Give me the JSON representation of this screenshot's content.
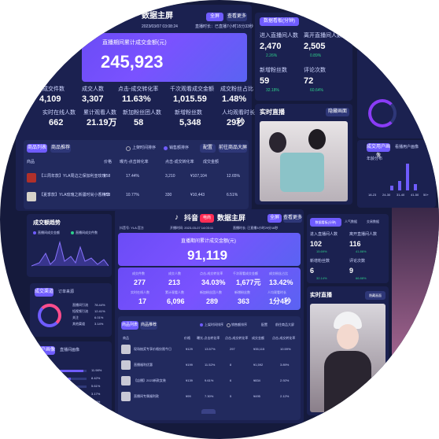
{
  "top": {
    "title": "数据主屏",
    "btn_full": "全屏",
    "btn_more": "查看更多",
    "date": "2023/03/07 03:08:24",
    "subinfo": "直播时长：已直播7小时15分33秒",
    "gmv_label": "直播期间累计成交金额(元)",
    "gmv": "245,923",
    "metrics": [
      {
        "label": "成交件数",
        "value": "4,109"
      },
      {
        "label": "成交人数",
        "value": "3,307"
      },
      {
        "label": "点击-成交转化率",
        "value": "11.63%"
      },
      {
        "label": "千次观看成交金额",
        "value": "1,015.59"
      },
      {
        "label": "成交粉丝占比",
        "value": "1.48%"
      },
      {
        "label": "实时在线人数",
        "value": "662"
      },
      {
        "label": "累计观看人数",
        "value": "21.19万"
      },
      {
        "label": "新加粉丝团人数",
        "value": "58"
      },
      {
        "label": "新增粉丝数",
        "value": "5,348"
      },
      {
        "label": "人均观看时长",
        "value": "29秒"
      }
    ],
    "tabs": [
      "商品列表",
      "商品推荐"
    ],
    "radio1": "上架时间排序",
    "radio2": "销售额排序",
    "btn_config": "配置",
    "btn_export": "前往商品大屏",
    "table_headers": [
      "商品",
      "价格",
      "曝光-点击转化率",
      "点击-成交转化率",
      "成交金额",
      "成交件数",
      "点击-成交转化率"
    ],
    "rows": [
      {
        "name": "【三周年款】YLA周边之保加利亚玫瑰",
        "price": "¥58",
        "c1": "17.44%",
        "c2": "3,210",
        "c3": "¥107,104",
        "c4": "12.65%"
      },
      {
        "name": "【夏季款】YLA玫瑰之新疆时尚小香精华",
        "price": "¥58",
        "c1": "10.77%",
        "c2": "330",
        "c3": "¥10,443",
        "c4": "6.51%"
      }
    ],
    "right_stats": [
      {
        "label": "进入直播间人数",
        "value": "2,470",
        "delta": "2.26%"
      },
      {
        "label": "离开直播间人数",
        "value": "2,505",
        "delta": "0.89%"
      },
      {
        "label": "新增粉丝数",
        "value": "59",
        "delta": "32.18%"
      },
      {
        "label": "评论次数",
        "value": "72",
        "delta": "60.64%"
      }
    ],
    "right_tab": "数据看板(分钟)",
    "live_label": "实时直播",
    "live_btn": "隐藏画面"
  },
  "chart": {
    "title": "成交额趋势",
    "legend": [
      "直播间成交金额",
      "直播间成交件数"
    ]
  },
  "main": {
    "brand": "抖音",
    "brand_tag": "电商",
    "title": "数据主屏",
    "btn_full": "全屏",
    "btn_more": "查看更多",
    "account": "抖音号: YLA.官方",
    "date": "开播时间: 2023-03-07 14:03:11",
    "duration": "直播时长: 已直播3小时29分18秒",
    "gmv_label": "直播期间累计成交金额(元)",
    "gmv": "91,119",
    "metrics": [
      {
        "label": "成交件数",
        "value": "277"
      },
      {
        "label": "成交人数",
        "value": "213"
      },
      {
        "label": "点击-成交转化率",
        "value": "34.03%"
      },
      {
        "label": "千次观看成交金额",
        "value": "1,677元"
      },
      {
        "label": "成交粉丝占比",
        "value": "13.42%"
      },
      {
        "label": "实时在线人数",
        "value": "17"
      },
      {
        "label": "累计观看人数",
        "value": "6,096"
      },
      {
        "label": "新加粉丝团人数",
        "value": "289"
      },
      {
        "label": "新增粉丝数",
        "value": "363"
      },
      {
        "label": "人均观看时长",
        "value": "1分4秒"
      }
    ],
    "tabs": [
      "商品列表",
      "商品推荐"
    ],
    "radio1": "上架时间排序",
    "radio2": "销售额排序",
    "btn_config": "配置",
    "btn_export": "前往商品大屏",
    "table_headers": [
      "商品",
      "价格",
      "曝光-点击转化率",
      "点击-成交转化率",
      "成交金额",
      "成交件数",
      "点击-成交转化率"
    ],
    "rows": [
      {
        "name": "现场抽奖专享价格仅限今日",
        "price": "¥129",
        "c1": "13.57%",
        "c2": "297",
        "c3": "¥35,115",
        "c4": "10.59%"
      },
      {
        "name": "直播福利优惠",
        "price": "¥199",
        "c1": "11.52%",
        "c2": "8",
        "c3": "¥1,592",
        "c4": "3.89%"
      },
      {
        "name": "【店播】2023新款女装",
        "price": "¥139",
        "c1": "9.61%",
        "c2": "6",
        "c3": "¥834",
        "c4": "2.92%"
      },
      {
        "name": "直播间专属福利款",
        "price": "¥99",
        "c1": "7.30%",
        "c2": "5",
        "c3": "¥495",
        "c4": "2.12%"
      }
    ]
  },
  "left": {
    "donut_tabs": [
      "成交渠道",
      "订单来源"
    ],
    "legend": [
      {
        "label": "直播间引流",
        "value": "78.44%"
      },
      {
        "label": "短视频引流",
        "value": "12.41%"
      },
      {
        "label": "关注",
        "value": "6.01%"
      },
      {
        "label": "其他渠道",
        "value": "3.14%"
      }
    ],
    "bar_tabs": [
      "用户画像",
      "直播间画像"
    ],
    "bars": [
      {
        "value": "11.98%"
      },
      {
        "value": "8.42%"
      },
      {
        "value": "5.61%"
      },
      {
        "value": "3.17%"
      },
      {
        "value": "1.20%"
      }
    ]
  },
  "right": {
    "tabs": [
      "数据看板(分钟)",
      "人气数据",
      "交易数据"
    ],
    "stats": [
      {
        "label": "进入直播间人数",
        "value": "102",
        "delta": "15.69%"
      },
      {
        "label": "离开直播间人数",
        "value": "116",
        "delta": "41.86%"
      },
      {
        "label": "新增粉丝数",
        "value": "6",
        "delta": "32.14%"
      },
      {
        "label": "评论次数",
        "value": "9",
        "delta": "66.88%"
      }
    ],
    "live_label": "实时直播",
    "live_btn": "隐藏画面",
    "age_tabs": [
      "成交用户画像",
      "看播用户画像"
    ],
    "age_label": "年龄分布",
    "age_ticks": [
      "18-23",
      "24-30",
      "31-40",
      "41-50",
      "50+"
    ]
  },
  "colors": {
    "accent": "#6f5cff",
    "bg": "#151a3c",
    "panel": "#222a5e",
    "green": "#2ecf8a",
    "pink": "#ff4d8d"
  }
}
